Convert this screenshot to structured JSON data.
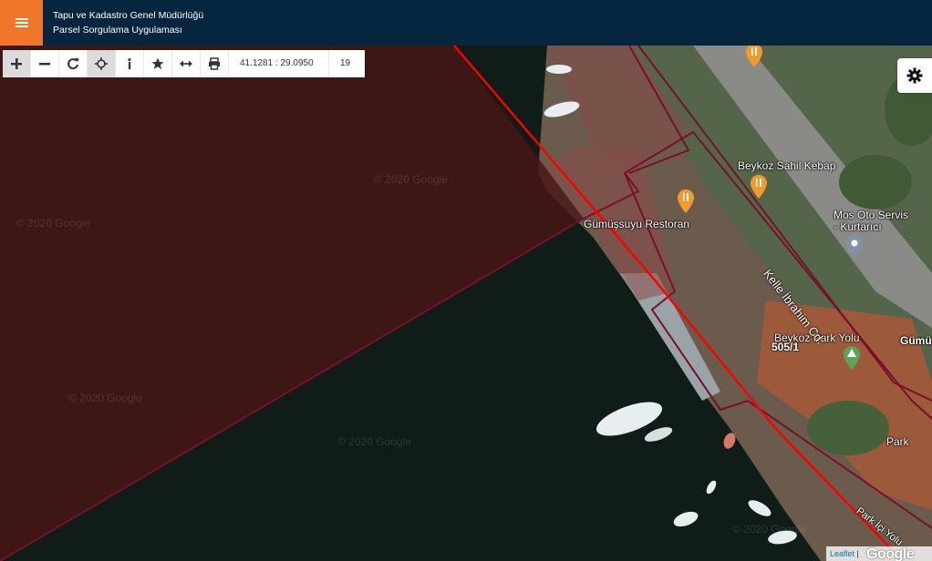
{
  "header": {
    "title_line1": "Tapu ve Kadastro Genel Müdürlüğü",
    "title_line2": "Parsel Sorgulama Uygulaması",
    "menu_icon": "hamburger-icon",
    "background": "#062640",
    "menu_color": "#f0772a"
  },
  "toolbar": {
    "buttons": [
      {
        "name": "zoom-in",
        "icon": "plus-icon"
      },
      {
        "name": "zoom-out",
        "icon": "minus-icon"
      },
      {
        "name": "refresh",
        "icon": "refresh-icon"
      },
      {
        "name": "locate",
        "icon": "crosshair-icon"
      },
      {
        "name": "info",
        "icon": "info-icon"
      },
      {
        "name": "favorite",
        "icon": "star-icon"
      },
      {
        "name": "measure",
        "icon": "measure-icon"
      },
      {
        "name": "print",
        "icon": "print-icon"
      }
    ],
    "coordinates": "41.1281 : 29.0950",
    "zoom": "19"
  },
  "settings": {
    "icon": "gear-icon"
  },
  "map": {
    "places": {
      "restaurant": "Gümüşsuyu Restoran",
      "kebap": "Beykoz Sahil Kebap",
      "oto_servis_line1": "Mos Oto Servis",
      "oto_servis_line2": "- Kurtarıcı",
      "park_yolu": "Beykoz Park Yolu",
      "park": "Park",
      "gumus": "Gümü"
    },
    "roads": {
      "kelle": "Kelle İbrahim Cd.",
      "park_ici": "Park İçi Yolu"
    },
    "parcel": "505/1",
    "watermark": "© 2020 Google",
    "colors": {
      "water": "#0d1a16",
      "parcel_fill": "#5a1a1a",
      "parcel_stroke": "#7a0f2a",
      "highlight_line": "#ff0000"
    }
  },
  "attribution": {
    "leaflet": "Leaflet",
    "separator": " | ",
    "google": "Google"
  }
}
